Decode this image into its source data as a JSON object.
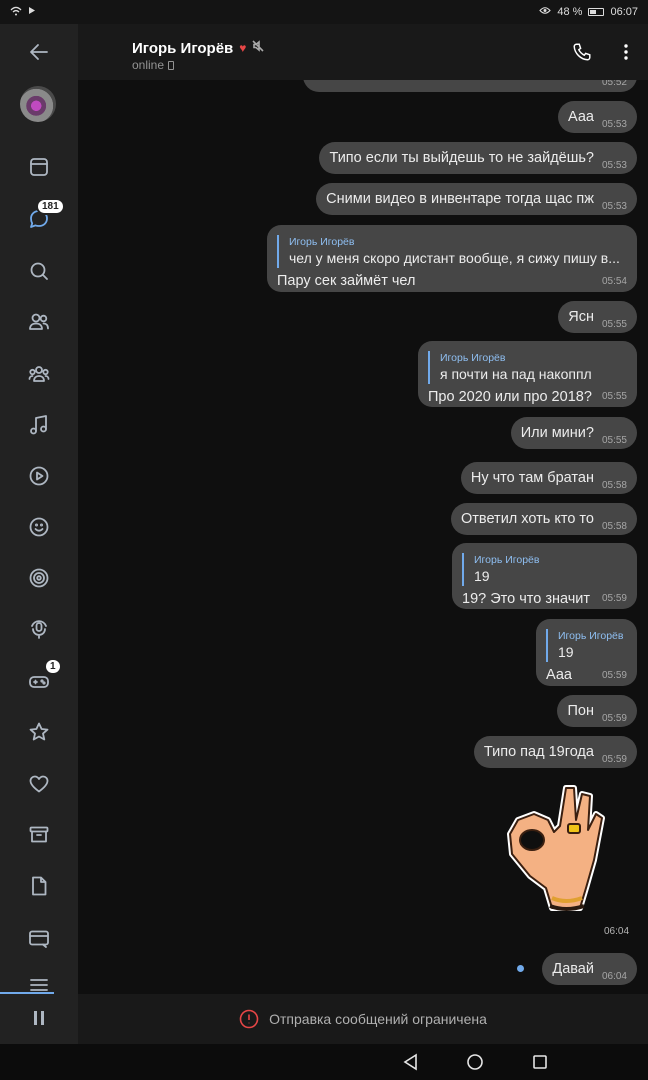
{
  "status_bar": {
    "battery": "48 %",
    "time": "06:07"
  },
  "sidebar": {
    "messages_badge": "181",
    "games_badge": "1"
  },
  "header": {
    "name": "Игорь Игорёв",
    "status": "online"
  },
  "messages": [
    {
      "text": "Ааа",
      "time": "05:53"
    },
    {
      "text": "Типо если ты выйдешь то не зайдёшь?",
      "time": "05:53"
    },
    {
      "text": "Сними видео в инвентаре тогда  щас  пж",
      "time": "05:53"
    },
    {
      "reply_name": "Игорь Игорёв",
      "reply_text": "чел у меня скоро дистант вообще, я сижу пишу в...",
      "text": "Пару сек займёт чел",
      "time": "05:54"
    },
    {
      "text": "Ясн",
      "time": "05:55"
    },
    {
      "reply_name": "Игорь Игорёв",
      "reply_text": "я почти на пад накоппл",
      "text": "Про 2020 или про 2018?",
      "time": "05:55"
    },
    {
      "text": "Или мини?",
      "time": "05:55"
    },
    {
      "text": "Ну что там братан",
      "time": "05:58"
    },
    {
      "text": "Ответил хоть кто то",
      "time": "05:58"
    },
    {
      "reply_name": "Игорь Игорёв",
      "reply_text": "19",
      "text": "19? Это что значит",
      "time": "05:59"
    },
    {
      "reply_name": "Игорь Игорёв",
      "reply_text": "19",
      "text": "Ааа",
      "time": "05:59"
    },
    {
      "text": "Пон",
      "time": "05:59"
    },
    {
      "text": "Типо пад 19года",
      "time": "05:59"
    },
    {
      "sticker": "ok-hand-sticker",
      "time": "06:04"
    },
    {
      "text": "Давай",
      "time": "06:04"
    }
  ],
  "footer": {
    "restriction": "Отправка сообщений ограничена"
  }
}
